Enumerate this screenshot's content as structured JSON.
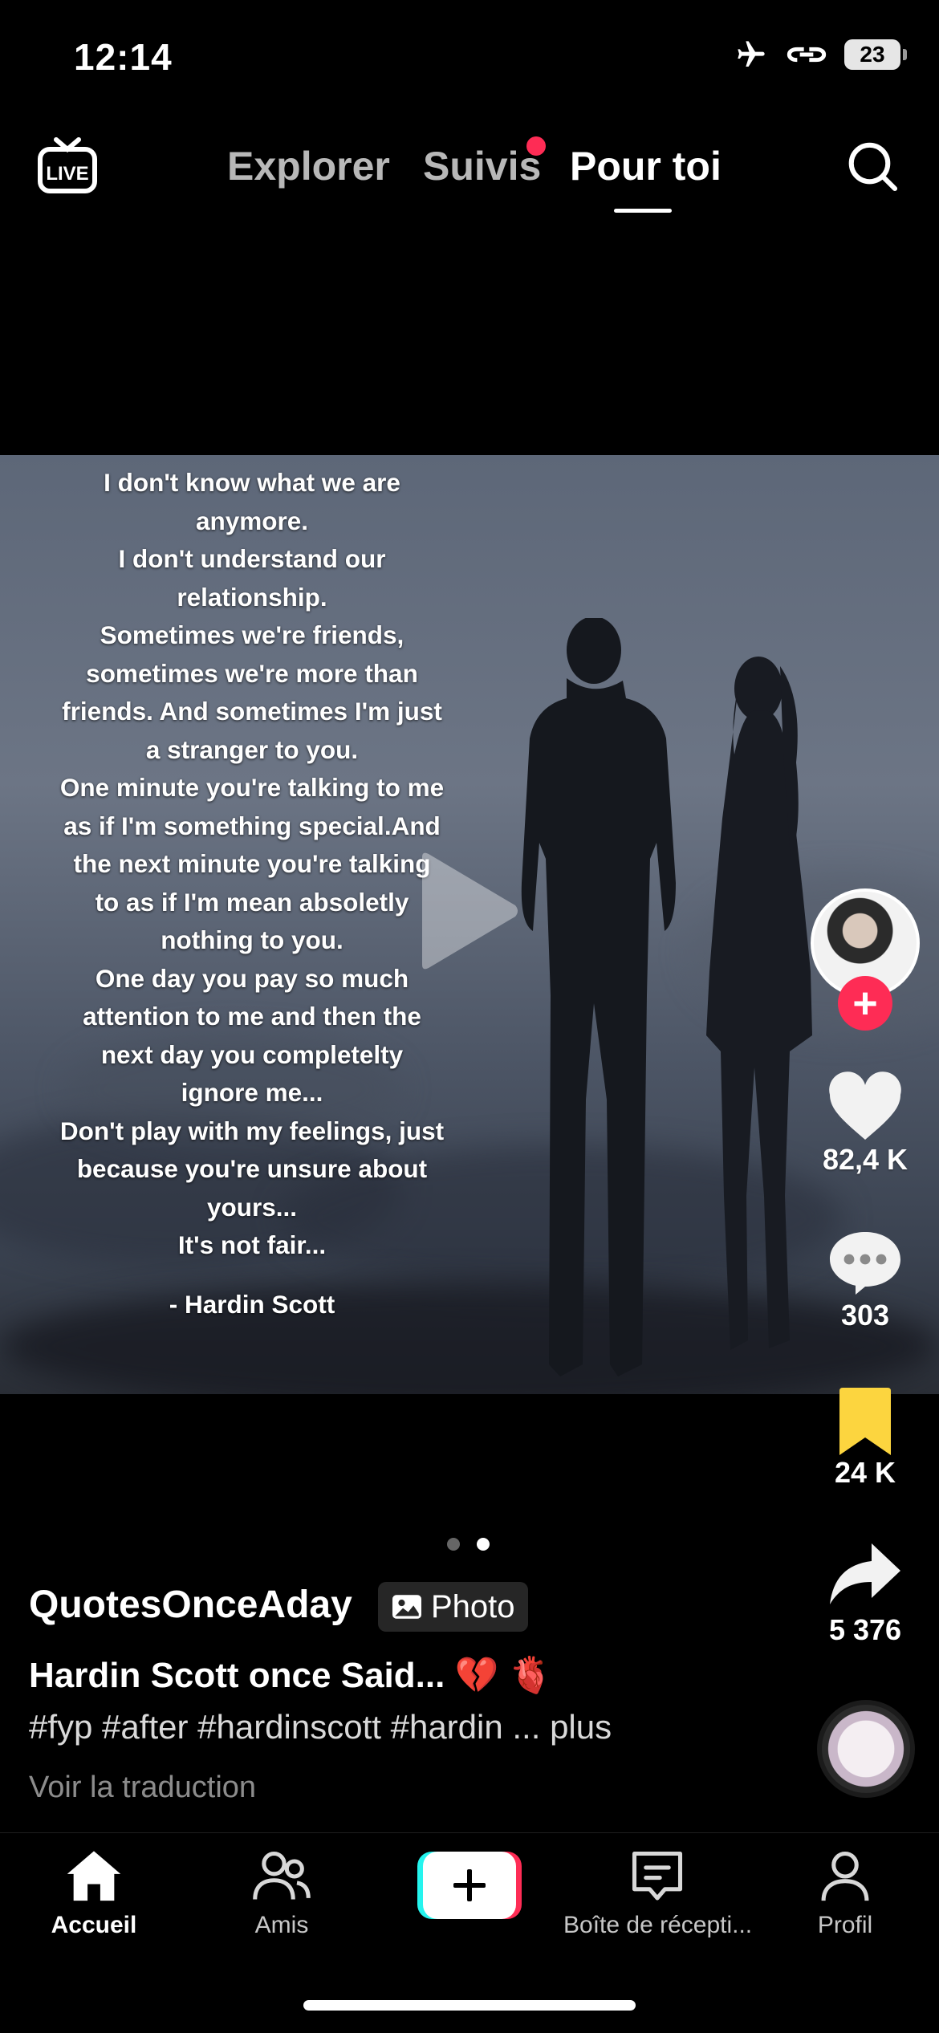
{
  "status_bar": {
    "time": "12:14",
    "battery": "23"
  },
  "top_nav": {
    "live_label": "LIVE",
    "tabs": [
      {
        "label": "Explorer",
        "active": false
      },
      {
        "label": "Suivis",
        "active": false,
        "has_notification": true
      },
      {
        "label": "Pour toi",
        "active": true
      }
    ]
  },
  "post": {
    "quote_lines": [
      "I don't know what we are",
      "anymore.",
      "I don't understand our",
      "relationship.",
      "Sometimes we're friends,",
      "sometimes we're more than",
      "friends. And sometimes I'm just",
      "a stranger to you.",
      "One minute you're talking to me",
      "as if I'm something special.And",
      "the next minute you're talking",
      "to as if I'm mean absoletly",
      "nothing to you.",
      "One day you pay so much",
      "attention to me and then the",
      "next day you completelty",
      "ignore me...",
      "Don't play with my feelings, just",
      "because you're unsure about",
      "yours...",
      "It's not fair..."
    ],
    "quote_author": "- Hardin Scott",
    "page_count": 2,
    "current_page": 2,
    "username": "QuotesOnceAday",
    "badge_label": "Photo",
    "caption_title": "Hardin Scott once Said... 💔 🫀",
    "hashtags": "#fyp #after #hardinscott #hardin ...",
    "more_label": "plus",
    "translate_label": "Voir la traduction"
  },
  "actions": {
    "likes": "82,4 K",
    "comments": "303",
    "saves": "24 K",
    "shares": "5 376"
  },
  "bottom_nav": {
    "items": [
      {
        "label": "Accueil",
        "icon": "home-icon",
        "active": true
      },
      {
        "label": "Amis",
        "icon": "friends-icon",
        "active": false
      },
      {
        "label": "",
        "icon": "create-icon",
        "active": false
      },
      {
        "label": "Boîte de récepti...",
        "icon": "inbox-icon",
        "active": false
      },
      {
        "label": "Profil",
        "icon": "profile-icon",
        "active": false
      }
    ]
  },
  "colors": {
    "accent": "#fe2c55",
    "save_active": "#fcd53f",
    "background": "#000000"
  }
}
